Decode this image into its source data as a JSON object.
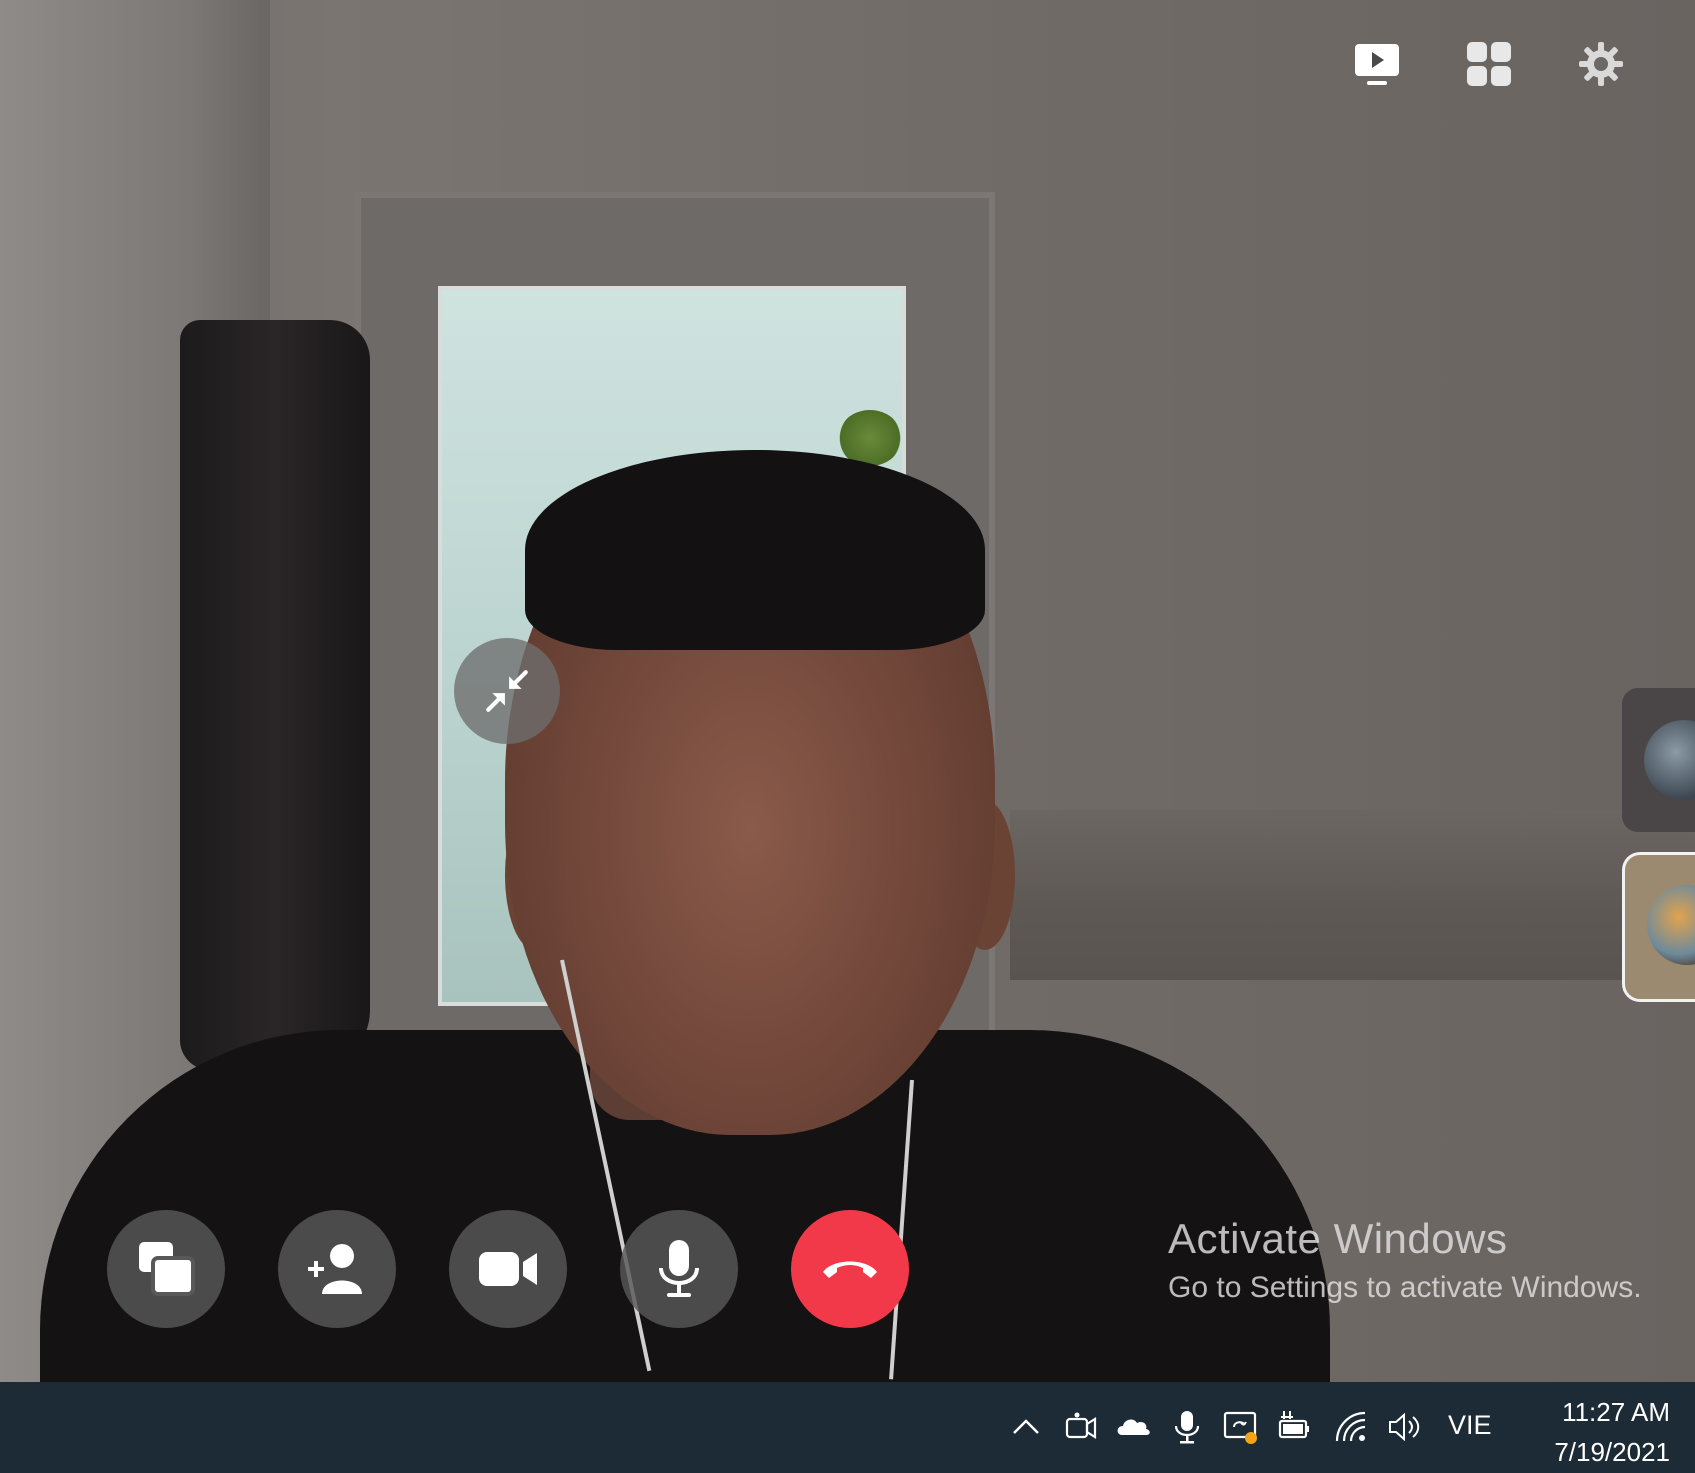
{
  "top_toolbar": {
    "icons": [
      "screen-share-icon",
      "grid-layout-icon",
      "settings-gear-icon"
    ]
  },
  "video": {
    "collapse_icon": "collapse-arrows-icon"
  },
  "participants": {
    "thumbnails": [
      "participant-thumbnail",
      "participant-thumbnail"
    ]
  },
  "call_controls": {
    "buttons": [
      {
        "name": "switch-view-button",
        "icon": "window-switch-icon"
      },
      {
        "name": "add-person-button",
        "icon": "add-person-icon"
      },
      {
        "name": "camera-button",
        "icon": "video-camera-icon"
      },
      {
        "name": "microphone-button",
        "icon": "microphone-icon"
      },
      {
        "name": "end-call-button",
        "icon": "hang-up-icon",
        "color": "#f2394a"
      }
    ]
  },
  "watermark": {
    "title": "Activate Windows",
    "subtitle": "Go to Settings to activate Windows."
  },
  "taskbar": {
    "background": "#1d2b36",
    "tray_icons": [
      "chevron-up-icon",
      "meet-now-icon",
      "onedrive-cloud-icon",
      "microphone-tray-icon",
      "display-notification-icon",
      "battery-charging-icon",
      "wifi-icon",
      "volume-icon"
    ],
    "language": "VIE",
    "time": "11:27 AM",
    "date": "7/19/2021"
  }
}
